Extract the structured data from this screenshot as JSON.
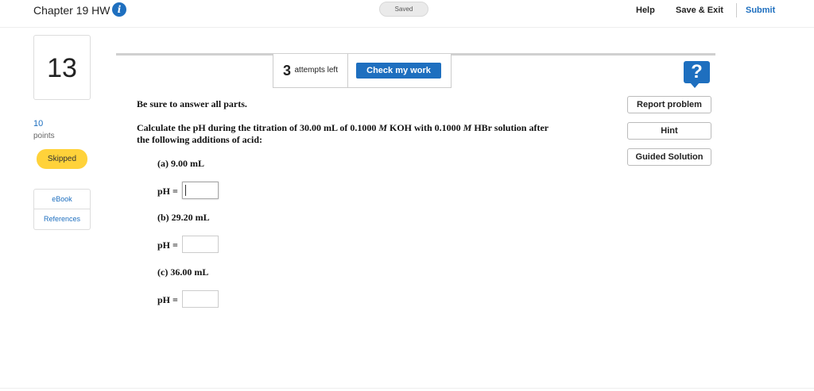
{
  "header": {
    "assignment_title": "Chapter 19 HW",
    "info_icon": "info-icon",
    "save_status": "Saved",
    "help_label": "Help",
    "save_exit_label": "Save & Exit",
    "submit_label": "Submit"
  },
  "sidebar": {
    "question_number": "13",
    "points_value": "10",
    "points_label": "points",
    "status_badge": "Skipped",
    "resources": [
      {
        "label": "eBook"
      },
      {
        "label": "References"
      }
    ]
  },
  "question_header": {
    "attempts_count": "3",
    "attempts_label": "attempts left",
    "check_button_label": "Check my work",
    "help_icon_glyph": "?"
  },
  "side_buttons": {
    "report_problem": "Report problem",
    "hint": "Hint",
    "guided_solution": "Guided Solution"
  },
  "question": {
    "instruction": "Be sure to answer all parts.",
    "prompt_line1_a": "Calculate the pH during the titration of 30.00 mL of 0.1000 ",
    "prompt_line1_M1": "M",
    "prompt_line1_b": " KOH with 0.1000 ",
    "prompt_line1_M2": "M",
    "prompt_line1_c": " HBr solution after",
    "prompt_line2": "the following additions of acid:",
    "parts": [
      {
        "label": "(a) 9.00 mL",
        "answer_label": "pH =",
        "value": ""
      },
      {
        "label": "(b) 29.20 mL",
        "answer_label": "pH =",
        "value": ""
      },
      {
        "label": "(c) 36.00 mL",
        "answer_label": "pH =",
        "value": ""
      }
    ]
  },
  "colors": {
    "accent_blue": "#1e6fbf",
    "skipped_yellow": "#ffd23a"
  }
}
